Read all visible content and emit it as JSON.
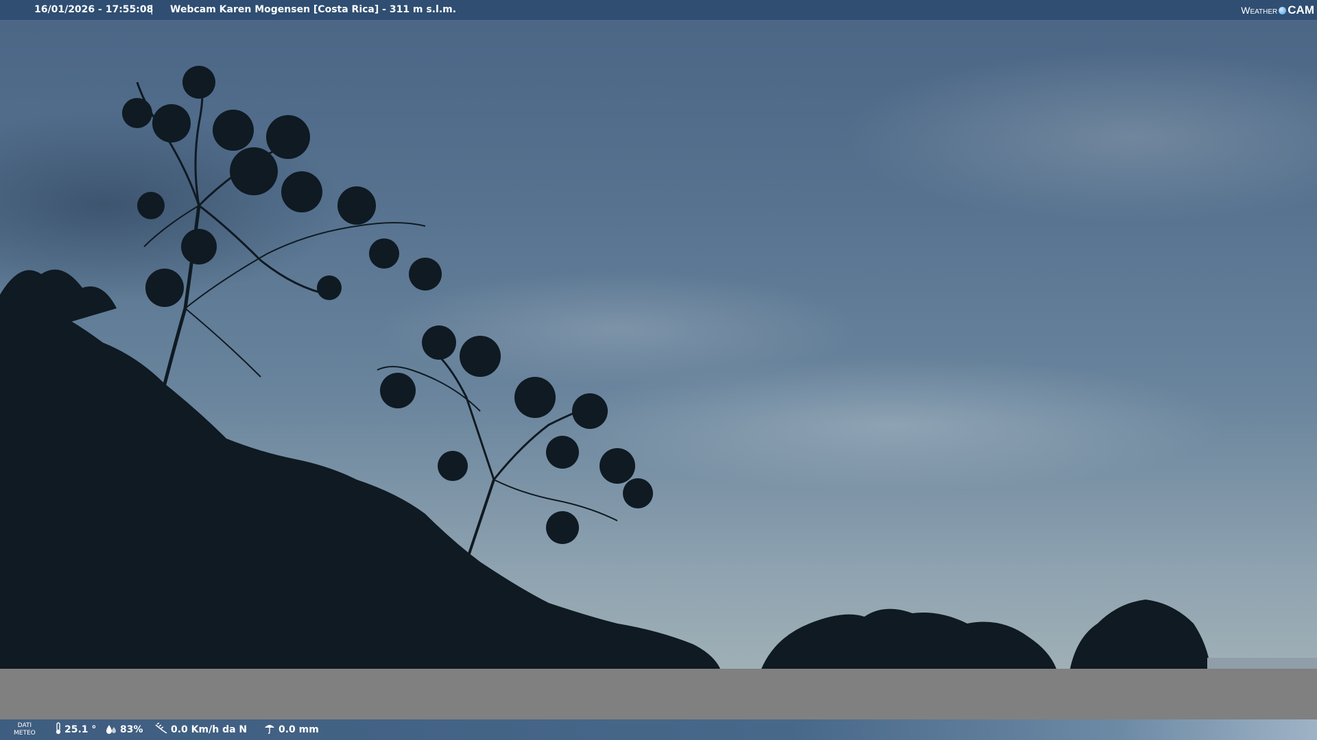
{
  "header": {
    "datetime": "16/01/2026 - 17:55:08",
    "separator": "|",
    "title": "Webcam Karen Mogensen [Costa Rica]  - 311 m s.l.m.",
    "logo_weather": "Weather",
    "logo_cam": "CAM"
  },
  "weather_bar": {
    "label_line1": "DATI",
    "label_line2": "METEO",
    "temperature": "25.1 °",
    "humidity": "83%",
    "wind": "0.0 Km/h da N",
    "rain": "0.0 mm",
    "icons": [
      "thermometer-icon",
      "humidity-icon",
      "wind-icon",
      "rain-icon"
    ]
  },
  "colors": {
    "header_bg": "#2f4e72",
    "bottom_bar_bg": "#48688a",
    "gray_band": "#808080",
    "sky_top": "#4a6585",
    "sky_bottom": "#9fb0b6",
    "foliage": "#0f1a22"
  }
}
